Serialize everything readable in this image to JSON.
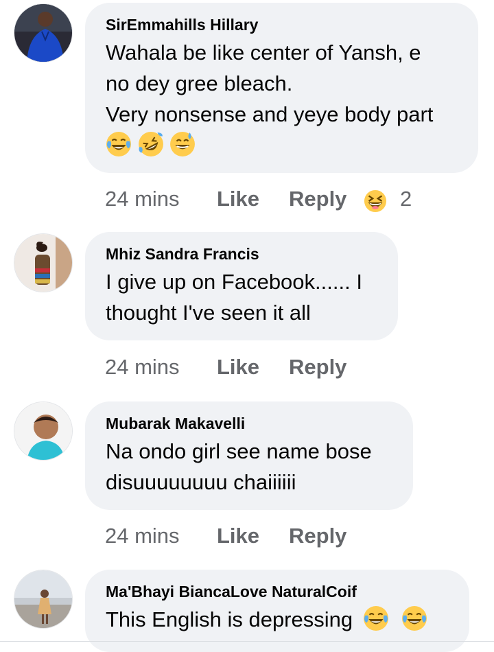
{
  "comments": [
    {
      "author": "SirEmmahills Hillary",
      "lines": [
        "Wahala be like center of Yansh, e",
        "no dey gree bleach.",
        "Very nonsense and yeye body part"
      ],
      "emojis": [
        "crying-laughing-emoji",
        "rolling-laughing-emoji",
        "grinning-sweat-emoji"
      ],
      "time": "24 mins",
      "like": "Like",
      "reply": "Reply",
      "reaction_icon": "laughing-reaction-icon",
      "reaction_count": "2"
    },
    {
      "author": "Mhiz Sandra Francis",
      "lines": [
        "I give up on Facebook...... I",
        "thought I've seen it all"
      ],
      "time": "24 mins",
      "like": "Like",
      "reply": "Reply"
    },
    {
      "author": "Mubarak Makavelli",
      "lines": [
        "Na ondo girl see name bose",
        "disuuuuuuuu chaiiiiii"
      ],
      "time": "24 mins",
      "like": "Like",
      "reply": "Reply"
    },
    {
      "author": "Ma'Bhayi BiancaLove NaturalCoif",
      "lines": [
        "This English is depressing"
      ],
      "emojis": [
        "crying-laughing-emoji",
        "crying-laughing-emoji"
      ],
      "time": "",
      "like": "",
      "reply": ""
    }
  ],
  "colors": {
    "bubble": "#f0f2f5",
    "name": "#050505",
    "meta": "#65676b",
    "emoji_yellow": "#ffcc4d",
    "tears": "#5dadec"
  }
}
